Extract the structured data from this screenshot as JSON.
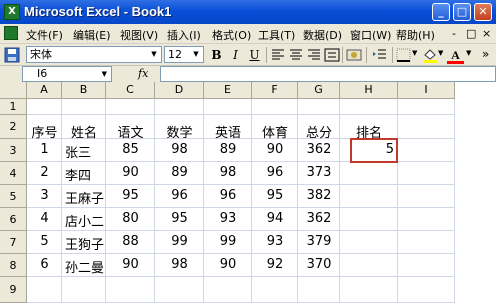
{
  "window": {
    "title": "Microsoft Excel - Book1",
    "app_icon": "X"
  },
  "window_buttons": {
    "minimize": "_",
    "restore": "□",
    "close": "✕"
  },
  "menu": {
    "items": [
      "文件(F)",
      "编辑(E)",
      "视图(V)",
      "插入(I)",
      "格式(O)",
      "工具(T)",
      "数据(D)",
      "窗口(W)",
      "帮助(H)"
    ],
    "right_controls": [
      "-",
      "□",
      "×"
    ]
  },
  "toolbar": {
    "font_name": "宋体",
    "font_size": "12",
    "bold": "B",
    "italic": "I",
    "underline": "U",
    "font_color_label": "A",
    "accent_colors": {
      "fill": "#ffff00",
      "font": "#ff0000"
    }
  },
  "formula_bar": {
    "name_box": "I6",
    "fx_label": "fx",
    "formula": ""
  },
  "sheet": {
    "columns": [
      "A",
      "B",
      "C",
      "D",
      "E",
      "F",
      "G",
      "H",
      "I"
    ],
    "rows": [
      "1",
      "2",
      "3",
      "4",
      "5",
      "6",
      "7",
      "8",
      "9"
    ],
    "header_row": [
      "序号",
      "姓名",
      "语文",
      "数学",
      "英语",
      "体育",
      "总分",
      "排名"
    ],
    "data": [
      [
        "1",
        "张三",
        "85",
        "98",
        "89",
        "90",
        "362",
        "5"
      ],
      [
        "2",
        "李四",
        "90",
        "89",
        "98",
        "96",
        "373",
        ""
      ],
      [
        "3",
        "王麻子",
        "95",
        "96",
        "96",
        "95",
        "382",
        ""
      ],
      [
        "4",
        "店小二",
        "80",
        "95",
        "93",
        "94",
        "362",
        ""
      ],
      [
        "5",
        "王狗子",
        "88",
        "99",
        "99",
        "93",
        "379",
        ""
      ],
      [
        "6",
        "孙二曼",
        "90",
        "98",
        "90",
        "92",
        "370",
        ""
      ]
    ],
    "selected_cell": "H3",
    "selection_color": "#c0392b"
  }
}
